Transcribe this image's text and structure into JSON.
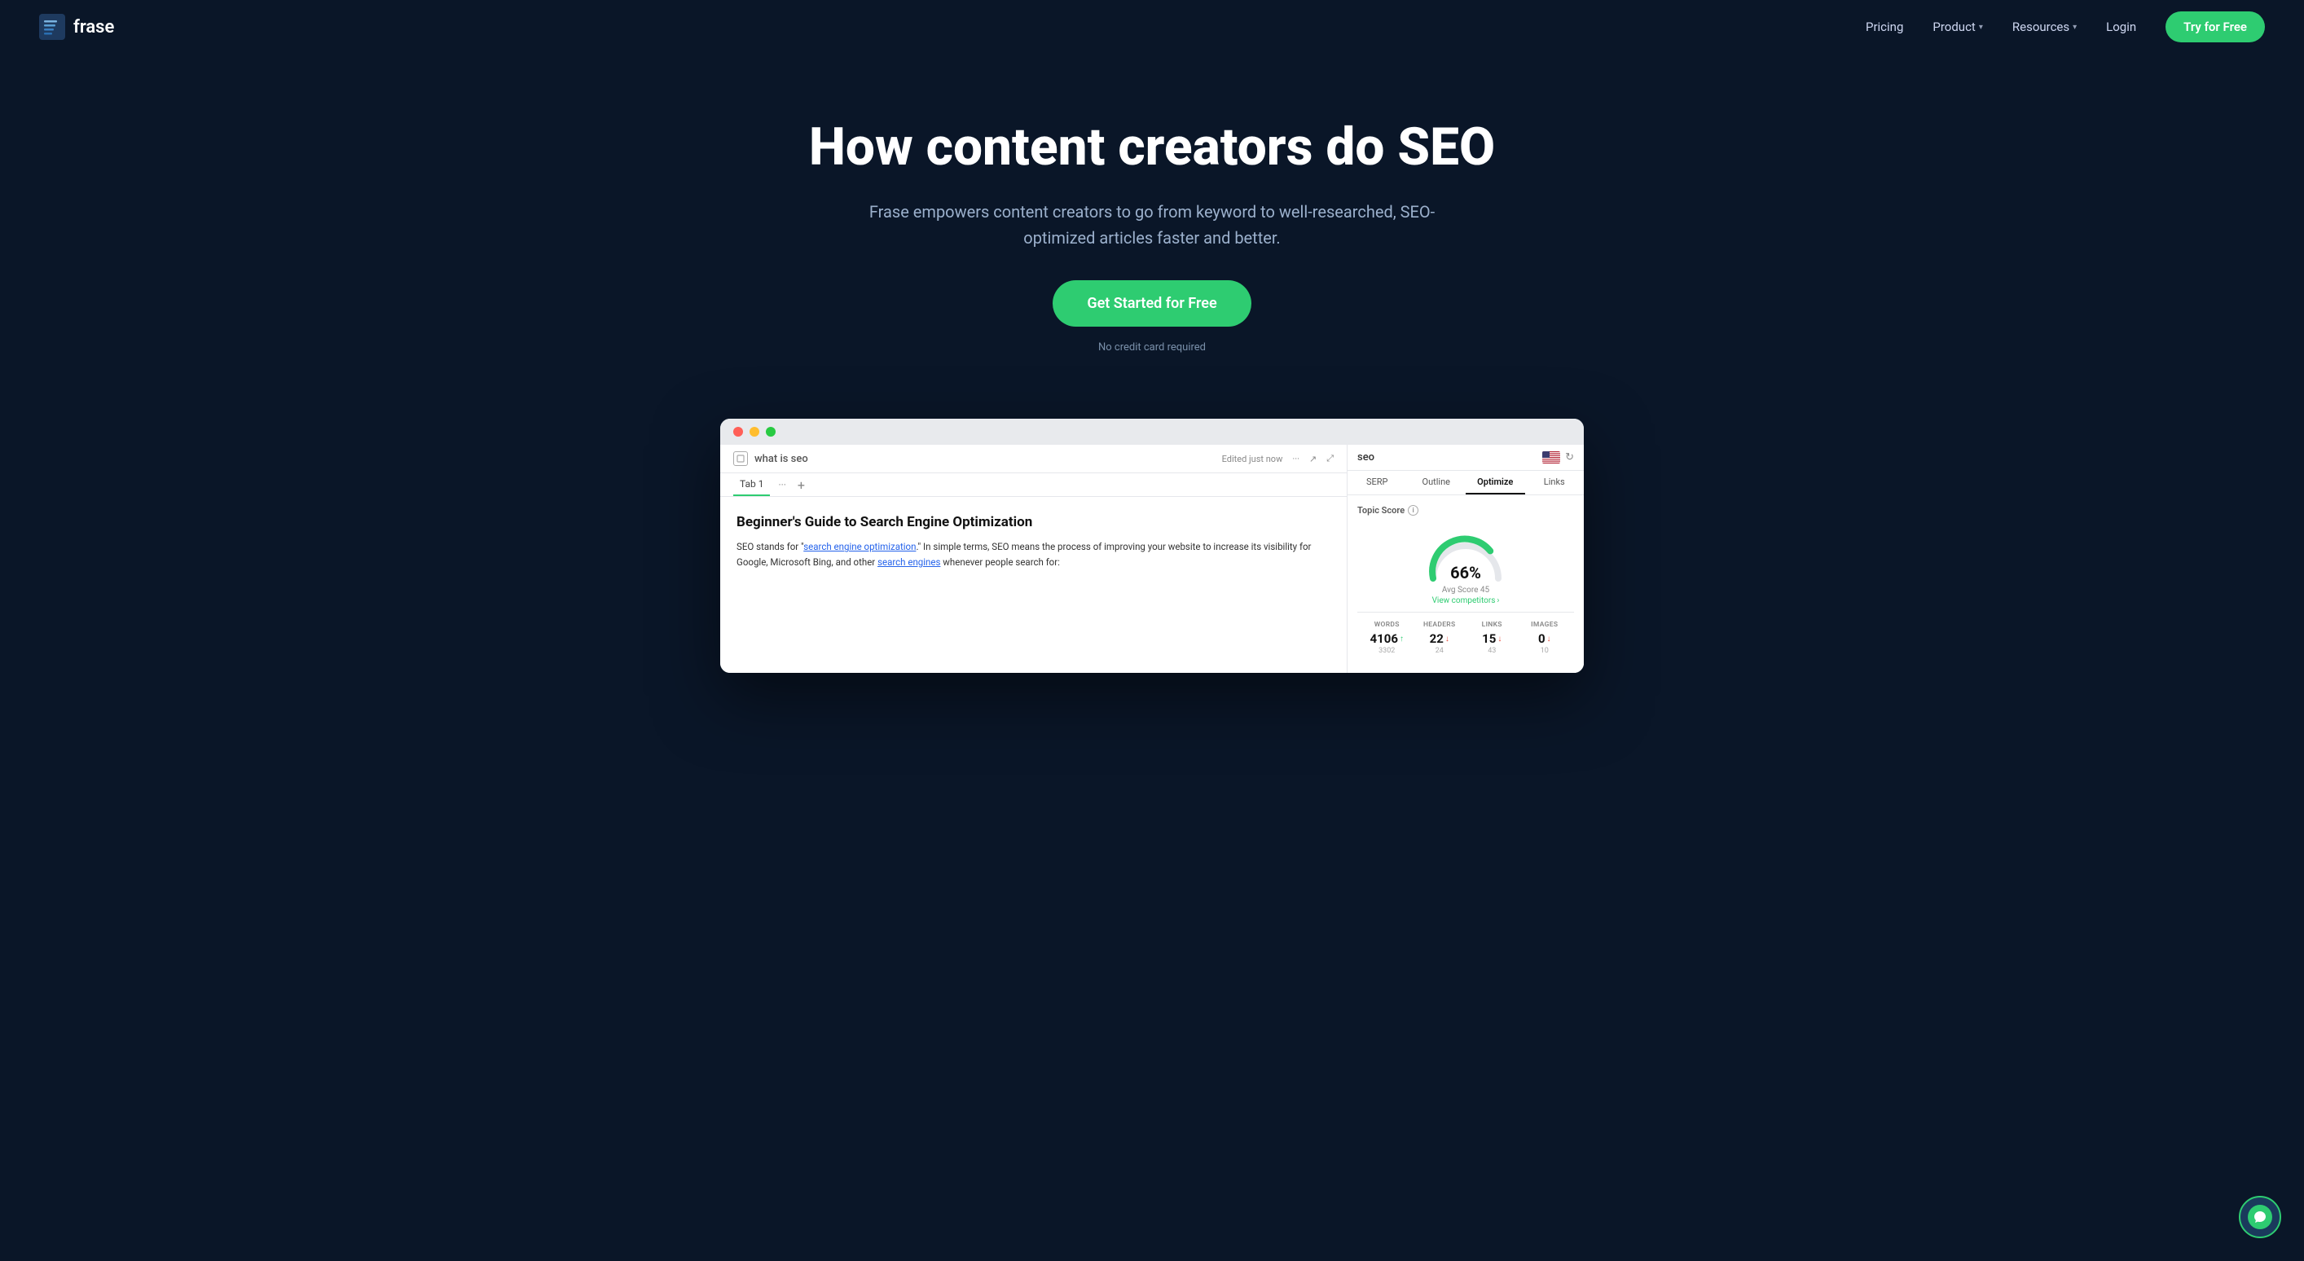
{
  "nav": {
    "logo_text": "frase",
    "links": [
      {
        "label": "Pricing",
        "has_dropdown": false
      },
      {
        "label": "Product",
        "has_dropdown": true
      },
      {
        "label": "Resources",
        "has_dropdown": true
      }
    ],
    "login_label": "Login",
    "cta_label": "Try for Free"
  },
  "hero": {
    "title": "How content creators do SEO",
    "subtitle": "Frase empowers content creators to go from keyword to well-researched, SEO-optimized articles faster and better.",
    "cta_label": "Get Started for Free",
    "sub_label": "No credit card required"
  },
  "mockup": {
    "doc_title": "what is seo",
    "edited_status": "Edited just now",
    "tab_label": "Tab 1",
    "article_heading": "Beginner's Guide to Search Engine Optimization",
    "article_body": "SEO stands for \"search engine optimization.\" In simple terms, SEO means the process of improving your website to increase its visibility for Google, Microsoft Bing, and other search engines whenever people search for:",
    "article_link1": "search engine optimization",
    "article_link2": "search engines",
    "seo_query": "seo",
    "seo_tabs": [
      "SERP",
      "Outline",
      "Optimize",
      "Links"
    ],
    "active_tab": "Optimize",
    "topic_score_label": "Topic Score",
    "gauge_percent": "66%",
    "avg_score_label": "Avg Score 45",
    "view_competitors": "View competitors",
    "stats": [
      {
        "label": "WORDS",
        "value": "4106",
        "arrow": "up",
        "sub": "3302"
      },
      {
        "label": "HEADERS",
        "value": "22",
        "arrow": "down",
        "sub": "24"
      },
      {
        "label": "LINKS",
        "value": "15",
        "arrow": "down",
        "sub": "43"
      },
      {
        "label": "IMAGES",
        "value": "0",
        "arrow": "down",
        "sub": "10"
      }
    ]
  },
  "colors": {
    "green": "#2ecc71",
    "bg_dark": "#0a1628",
    "text_muted": "#9bb0cc"
  }
}
